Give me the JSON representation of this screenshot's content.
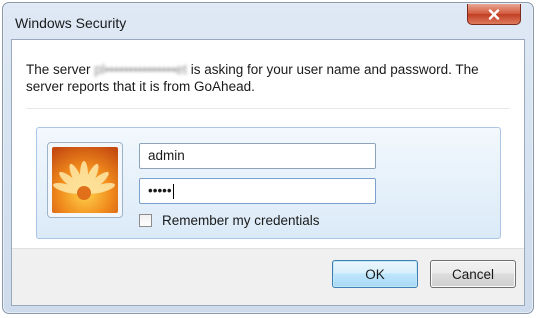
{
  "window": {
    "title": "Windows Security"
  },
  "message": {
    "prefix": "The server ",
    "server_name_obscured": "pl•••••••••••••••et",
    "suffix": " is asking for your user name and password. The server reports that it is from GoAhead."
  },
  "credentials": {
    "username_value": "admin",
    "password_masked": "•••••",
    "remember_label": "Remember my credentials",
    "remember_checked": false
  },
  "buttons": {
    "ok_label": "OK",
    "cancel_label": "Cancel"
  },
  "icons": {
    "close": "close-icon",
    "user_tile": "flower-user-tile-icon"
  },
  "colors": {
    "close_button": "#c9452a",
    "panel_border": "#a9c6e4",
    "ok_button_border": "#3c7fb1"
  }
}
